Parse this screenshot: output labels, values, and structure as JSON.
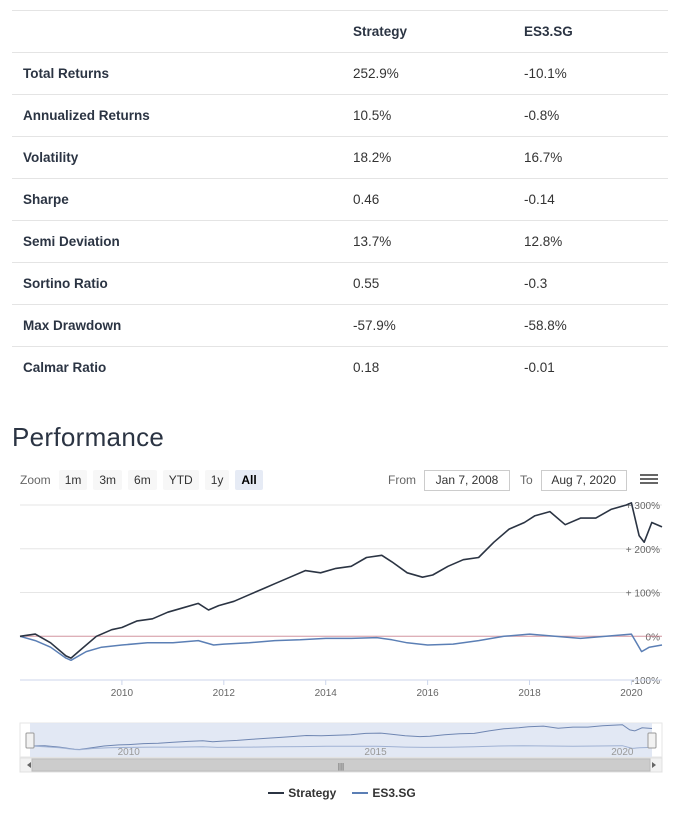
{
  "stats_table": {
    "headers": [
      "",
      "Strategy",
      "ES3.SG"
    ],
    "rows": [
      {
        "metric": "Total Returns",
        "strategy": "252.9%",
        "benchmark": "-10.1%"
      },
      {
        "metric": "Annualized Returns",
        "strategy": "10.5%",
        "benchmark": "-0.8%"
      },
      {
        "metric": "Volatility",
        "strategy": "18.2%",
        "benchmark": "16.7%"
      },
      {
        "metric": "Sharpe",
        "strategy": "0.46",
        "benchmark": "-0.14"
      },
      {
        "metric": "Semi Deviation",
        "strategy": "13.7%",
        "benchmark": "12.8%"
      },
      {
        "metric": "Sortino Ratio",
        "strategy": "0.55",
        "benchmark": "-0.3"
      },
      {
        "metric": "Max Drawdown",
        "strategy": "-57.9%",
        "benchmark": "-58.8%"
      },
      {
        "metric": "Calmar Ratio",
        "strategy": "0.18",
        "benchmark": "-0.01"
      }
    ]
  },
  "performance": {
    "title": "Performance",
    "zoom_label": "Zoom",
    "zoom_buttons": [
      "1m",
      "3m",
      "6m",
      "YTD",
      "1y",
      "All"
    ],
    "active_zoom": "All",
    "from_label": "From",
    "from_date": "Jan 7, 2008",
    "to_label": "To",
    "to_date": "Aug 7, 2020",
    "menu_icon": "hamburger-menu-icon"
  },
  "chart_data": {
    "type": "line",
    "x_ticks": [
      "2010",
      "2012",
      "2014",
      "2016",
      "2018",
      "2020"
    ],
    "y_ticks": [
      "+ 300%",
      "+ 200%",
      "+ 100%",
      "0%",
      "-100%"
    ],
    "ylim": [
      -100,
      300
    ],
    "xlim": [
      2008.0,
      2020.6
    ],
    "navigator_ticks": [
      "2010",
      "2015",
      "2020"
    ],
    "colors": {
      "strategy": "#2b3443",
      "benchmark": "#5b7fb5",
      "navigator_fill": "#dfe6f3",
      "zero_line": "#cc6677"
    },
    "series": [
      {
        "name": "Strategy",
        "x": [
          2008.0,
          2008.3,
          2008.6,
          2008.9,
          2009.0,
          2009.2,
          2009.5,
          2009.8,
          2010.0,
          2010.3,
          2010.6,
          2010.9,
          2011.2,
          2011.5,
          2011.7,
          2011.9,
          2012.2,
          2012.5,
          2012.8,
          2013.0,
          2013.3,
          2013.6,
          2013.9,
          2014.2,
          2014.5,
          2014.8,
          2015.1,
          2015.3,
          2015.6,
          2015.9,
          2016.1,
          2016.4,
          2016.7,
          2017.0,
          2017.3,
          2017.6,
          2017.9,
          2018.1,
          2018.4,
          2018.7,
          2019.0,
          2019.3,
          2019.6,
          2019.9,
          2020.0,
          2020.15,
          2020.25,
          2020.4,
          2020.6
        ],
        "values": [
          0,
          5,
          -15,
          -45,
          -50,
          -30,
          0,
          15,
          20,
          35,
          40,
          55,
          65,
          75,
          60,
          70,
          80,
          95,
          110,
          120,
          135,
          150,
          145,
          155,
          160,
          180,
          185,
          170,
          145,
          135,
          140,
          160,
          175,
          180,
          215,
          245,
          260,
          275,
          285,
          255,
          270,
          270,
          290,
          300,
          305,
          230,
          215,
          260,
          250
        ]
      },
      {
        "name": "ES3.SG",
        "x": [
          2008.0,
          2008.3,
          2008.6,
          2008.9,
          2009.0,
          2009.3,
          2009.6,
          2010.0,
          2010.5,
          2011.0,
          2011.5,
          2011.8,
          2012.0,
          2012.5,
          2013.0,
          2013.5,
          2014.0,
          2014.5,
          2015.0,
          2015.3,
          2015.6,
          2016.0,
          2016.5,
          2017.0,
          2017.5,
          2018.0,
          2018.5,
          2019.0,
          2019.5,
          2020.0,
          2020.2,
          2020.35,
          2020.6
        ],
        "values": [
          0,
          -10,
          -25,
          -50,
          -55,
          -35,
          -25,
          -20,
          -15,
          -15,
          -10,
          -20,
          -18,
          -15,
          -10,
          -8,
          -5,
          -5,
          -3,
          -8,
          -15,
          -20,
          -18,
          -10,
          0,
          5,
          0,
          -5,
          0,
          5,
          -35,
          -25,
          -20
        ]
      }
    ]
  },
  "legend": [
    {
      "name": "Strategy",
      "color": "#2b3443"
    },
    {
      "name": "ES3.SG",
      "color": "#5b7fb5"
    }
  ]
}
